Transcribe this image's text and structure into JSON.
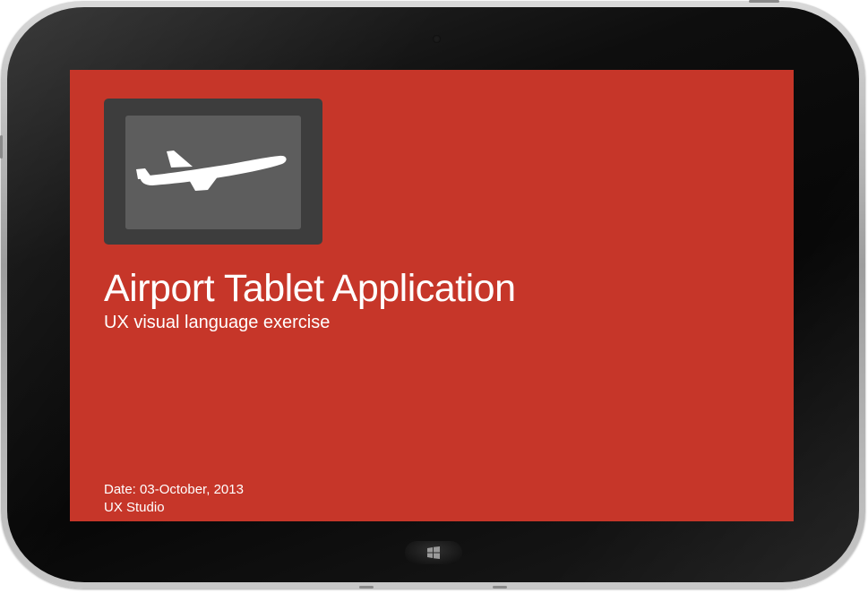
{
  "slide": {
    "title": "Airport Tablet Application",
    "subtitle": "UX visual language exercise",
    "date": "Date: 03-October, 2013",
    "organization": "UX Studio",
    "logo_icon": "airplane-icon",
    "background_color": "#c63629"
  },
  "device": {
    "home_button_icon": "windows-logo-icon"
  }
}
